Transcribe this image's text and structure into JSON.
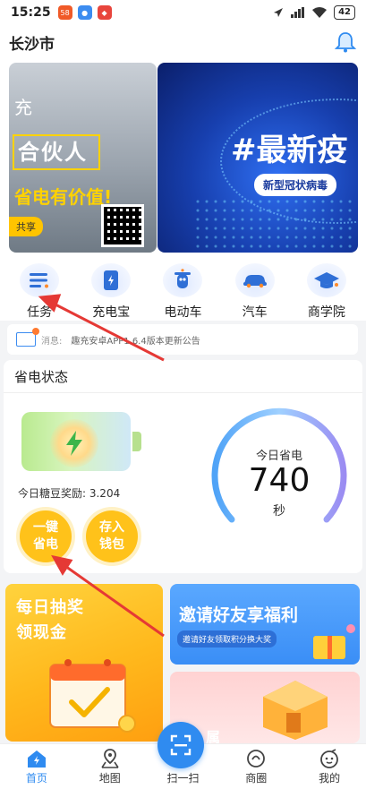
{
  "status_bar": {
    "time": "15:25",
    "app_badges": [
      "58",
      "",
      ""
    ],
    "battery": "42"
  },
  "header": {
    "city": "长沙市"
  },
  "banner": {
    "left": {
      "line1": "充",
      "box_text": "合伙人",
      "line2": "省电有价值!",
      "share": "共享"
    },
    "right": {
      "title": "#最新疫",
      "subtitle": "新型冠状病毒"
    },
    "pages": 2,
    "active_page": 1
  },
  "quick_menu": [
    {
      "label": "任务",
      "icon": "list-icon"
    },
    {
      "label": "充电宝",
      "icon": "powerbank-icon"
    },
    {
      "label": "电动车",
      "icon": "scooter-icon"
    },
    {
      "label": "汽车",
      "icon": "car-icon"
    },
    {
      "label": "商学院",
      "icon": "graduation-cap-icon"
    }
  ],
  "notice": {
    "tag": "消息:",
    "text": "趣充安卓APP1.6.4版本更新公告"
  },
  "power_state": {
    "title": "省电状态",
    "reward": "今日糖豆奖励: 3.204",
    "btn_save": [
      "一键",
      "省电"
    ],
    "btn_wallet": [
      "存入",
      "钱包"
    ],
    "gauge": {
      "label": "今日省电",
      "value": "740",
      "unit": "秒"
    }
  },
  "promos": {
    "lottery": {
      "line1": "每日抽奖",
      "line2": "领现金"
    },
    "invite": {
      "title": "邀请好友享福利",
      "subtitle": "邀请好友领取积分换大奖"
    },
    "shop": {
      "text": "属"
    }
  },
  "bottom_nav": [
    {
      "label": "首页",
      "active": true
    },
    {
      "label": "地图",
      "active": false
    },
    {
      "label": "扫一扫",
      "active": false
    },
    {
      "label": "商圈",
      "active": false
    },
    {
      "label": "我的",
      "active": false
    }
  ],
  "colors": {
    "primary": "#2f8bf0",
    "accent": "#ffc21a",
    "annotation": "#e53935"
  }
}
